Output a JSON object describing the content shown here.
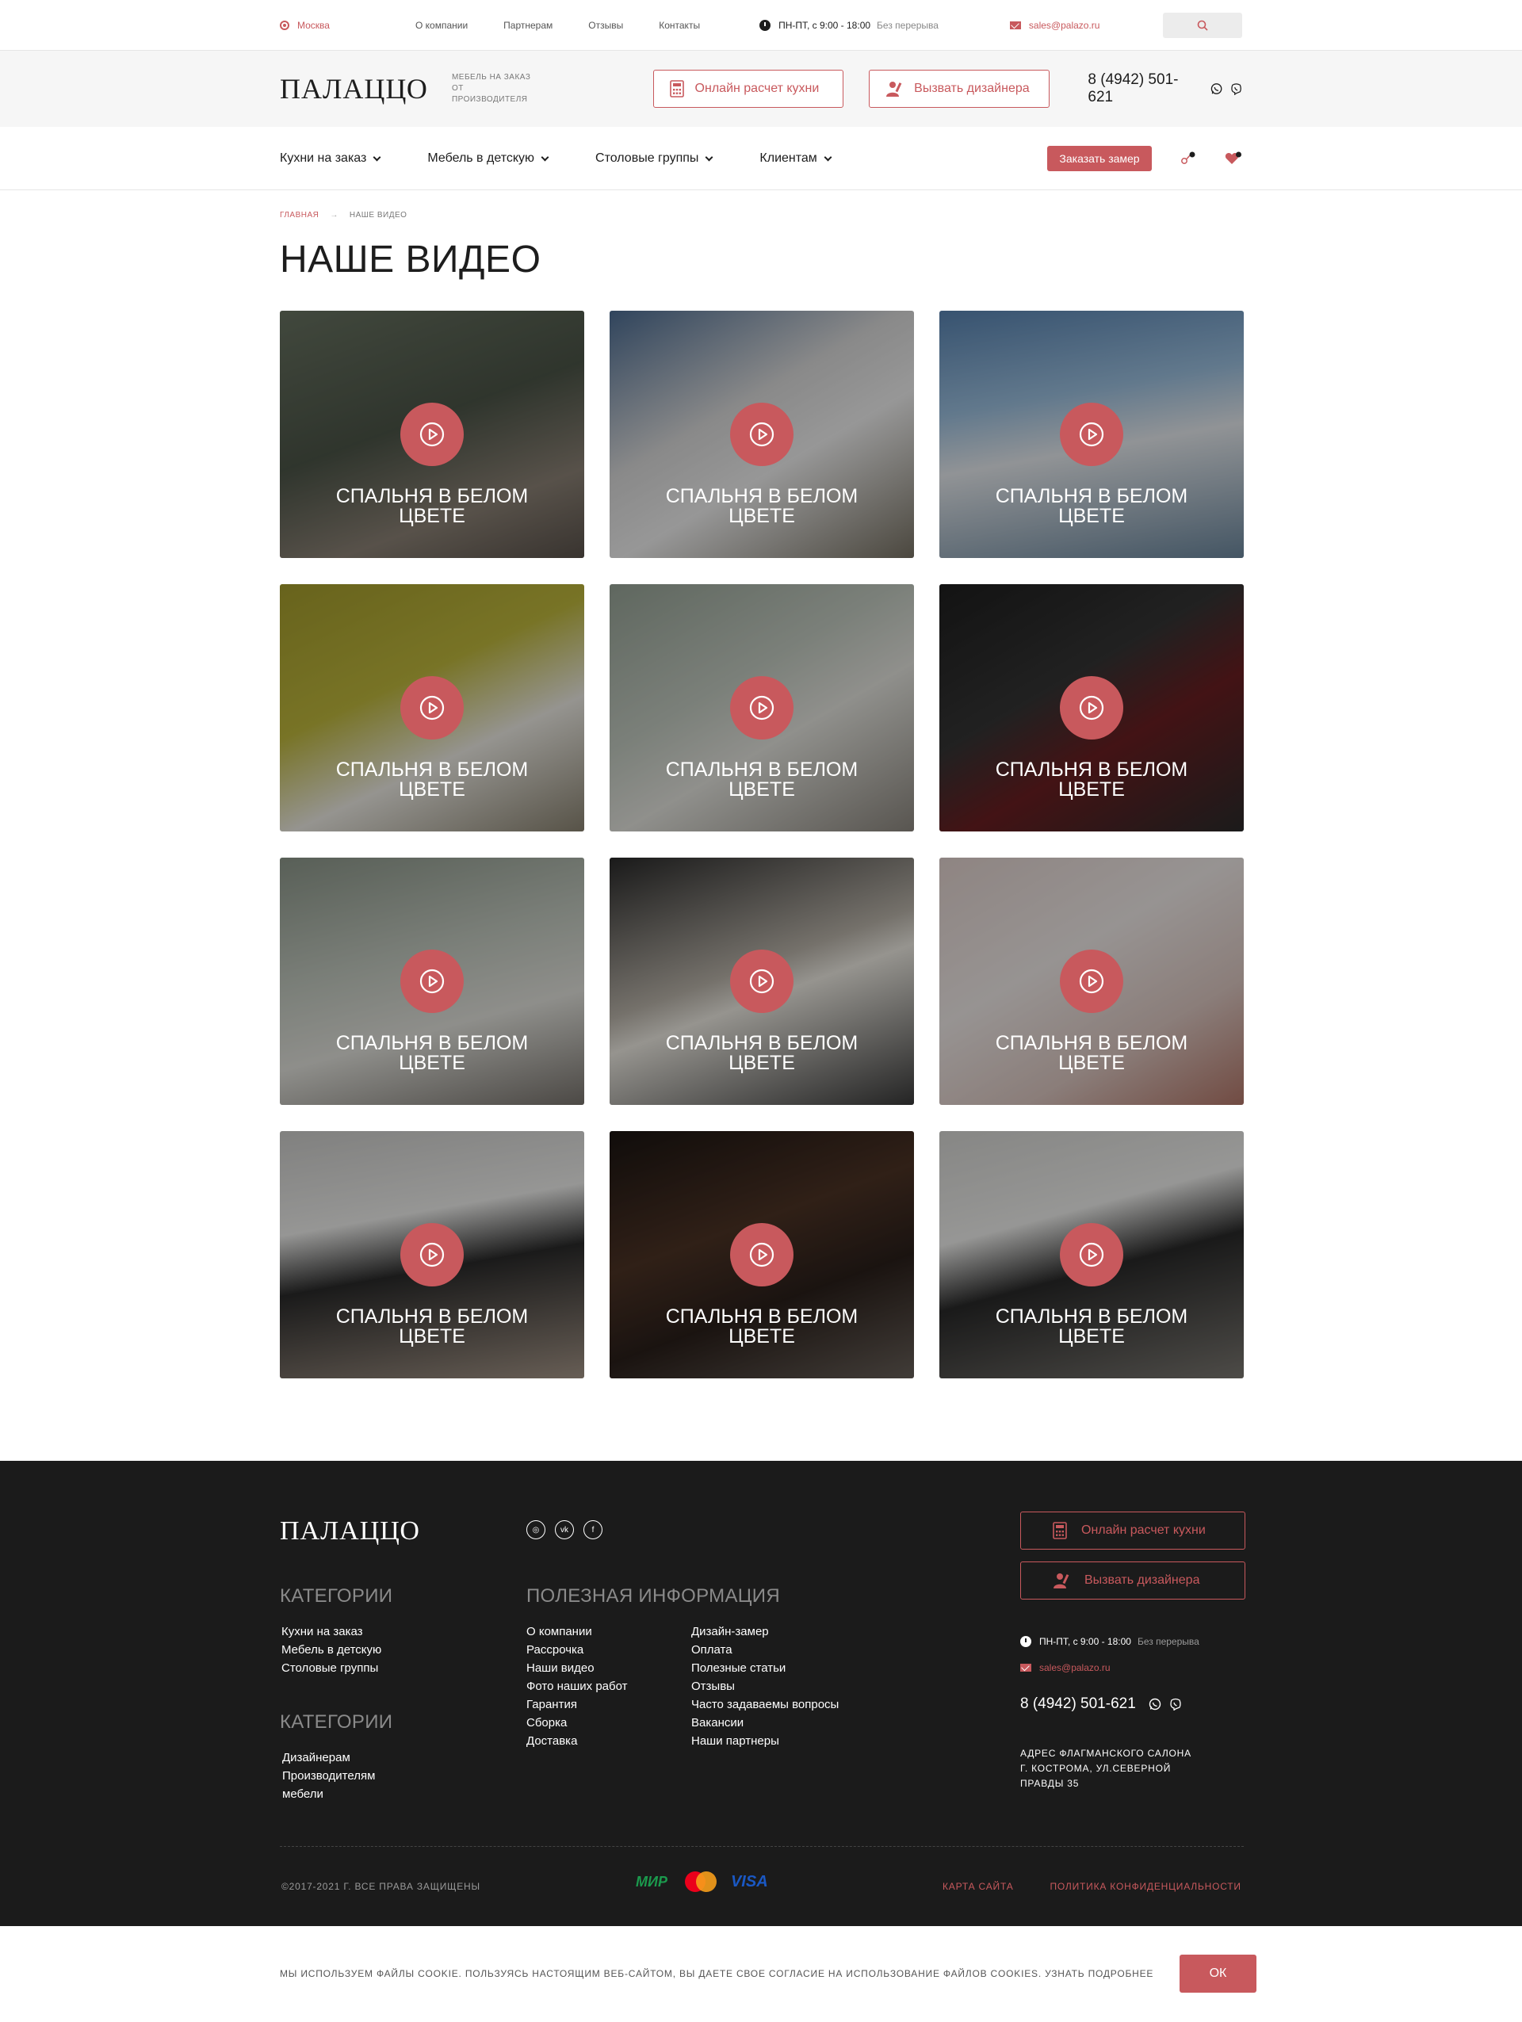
{
  "colors": {
    "accent": "#c8595d",
    "dark": "#1b1b1b",
    "text": "#1d1d1d"
  },
  "topbar": {
    "city": "Москва",
    "links": [
      "О компании",
      "Партнерам",
      "Отзывы",
      "Контакты"
    ],
    "hours": "ПН-ПТ, с 9:00 - 18:00",
    "hours_note": "Без перерыва",
    "email": "sales@palazo.ru",
    "search_icon": "search-icon"
  },
  "header": {
    "logo": "ПАЛАЦЦО",
    "tagline_1": "МЕБЕЛЬ НА ЗАКАЗ",
    "tagline_2": "ОТ ПРОИЗВОДИТЕЛЯ",
    "btn_kitchen": "Онлайн расчет кухни",
    "btn_designer": "Вызвать дизайнера",
    "phone": "8 (4942) 501-621"
  },
  "nav": {
    "items": [
      "Кухни на заказ",
      "Мебель в детскую",
      "Столовые группы",
      "Клиентам"
    ],
    "order_button": "Заказать замер"
  },
  "breadcrumb": {
    "home": "ГЛАВНАЯ",
    "separator": "→",
    "current": "НАШЕ ВИДЕО"
  },
  "page_title": "НАШЕ ВИДЕО",
  "videos": [
    {
      "title": "СПАЛЬНЯ В БЕЛОМ ЦВЕТЕ"
    },
    {
      "title": "СПАЛЬНЯ В БЕЛОМ ЦВЕТЕ"
    },
    {
      "title": "СПАЛЬНЯ В БЕЛОМ ЦВЕТЕ"
    },
    {
      "title": "СПАЛЬНЯ В БЕЛОМ ЦВЕТЕ"
    },
    {
      "title": "СПАЛЬНЯ В БЕЛОМ ЦВЕТЕ"
    },
    {
      "title": "СПАЛЬНЯ В БЕЛОМ ЦВЕТЕ"
    },
    {
      "title": "СПАЛЬНЯ В БЕЛОМ ЦВЕТЕ"
    },
    {
      "title": "СПАЛЬНЯ В БЕЛОМ ЦВЕТЕ"
    },
    {
      "title": "СПАЛЬНЯ В БЕЛОМ ЦВЕТЕ"
    },
    {
      "title": "СПАЛЬНЯ В БЕЛОМ ЦВЕТЕ"
    },
    {
      "title": "СПАЛЬНЯ В БЕЛОМ ЦВЕТЕ"
    },
    {
      "title": "СПАЛЬНЯ В БЕЛОМ ЦВЕТЕ"
    }
  ],
  "footer": {
    "logo": "ПАЛАЦЦО",
    "social": [
      "instagram-icon",
      "vk-icon",
      "facebook-icon"
    ],
    "social_glyphs": [
      "◎",
      "vk",
      "f"
    ],
    "btn_kitchen": "Онлайн расчет кухни",
    "btn_designer": "Вызвать дизайнера",
    "cat1_title": "КАТЕГОРИИ",
    "cat1_items": [
      "Кухни на заказ",
      "Мебель в детскую",
      "Столовые группы"
    ],
    "cat2_title": "КАТЕГОРИИ",
    "cat2_items": [
      "Дизайнерам",
      "Производителям",
      "мебели"
    ],
    "info_title": "ПОЛЕЗНАЯ ИНФОРМАЦИЯ",
    "info_col1": [
      "О компании",
      "Рассрочка",
      "Наши видео",
      "Фото наших работ",
      "Гарантия",
      "Сборка",
      "Доставка"
    ],
    "info_col2": [
      "Дизайн-замер",
      "Оплата",
      "Полезные статьи",
      "Отзывы",
      "Часто задаваемы вопросы",
      "Вакансии",
      "Наши партнеры"
    ],
    "hours": "ПН-ПТ, с 9:00 - 18:00",
    "hours_note": "Без перерыва",
    "email": "sales@palazo.ru",
    "phone": "8 (4942) 501-621",
    "address": [
      "АДРЕС ФЛАГМАНСКОГО САЛОНА",
      "Г. КОСТРОМА, УЛ.СЕВЕРНОЙ",
      "ПРАВДЫ 35"
    ],
    "copyright": "©2017-2021 Г. ВСЕ ПРАВА ЗАЩИЩЕНЫ",
    "payments": {
      "mir": "МИР",
      "mastercard": "MasterCard",
      "visa": "VISA"
    },
    "sitemap": "КАРТА САЙТА",
    "privacy": "ПОЛИТИКА КОНФИДЕНЦИАЛЬНОСТИ"
  },
  "cookie": {
    "text": "МЫ ИСПОЛЬЗУЕМ ФАЙЛЫ COOKIE. ПОЛЬЗУЯСЬ НАСТОЯЩИМ ВЕБ-САЙТОМ, ВЫ ДАЕТЕ СВОЕ СОГЛАСИЕ НА ИСПОЛЬЗОВАНИЕ ФАЙЛОВ COOKIES. УЗНАТЬ ПОДРОБНЕЕ",
    "ok": "ОК"
  }
}
